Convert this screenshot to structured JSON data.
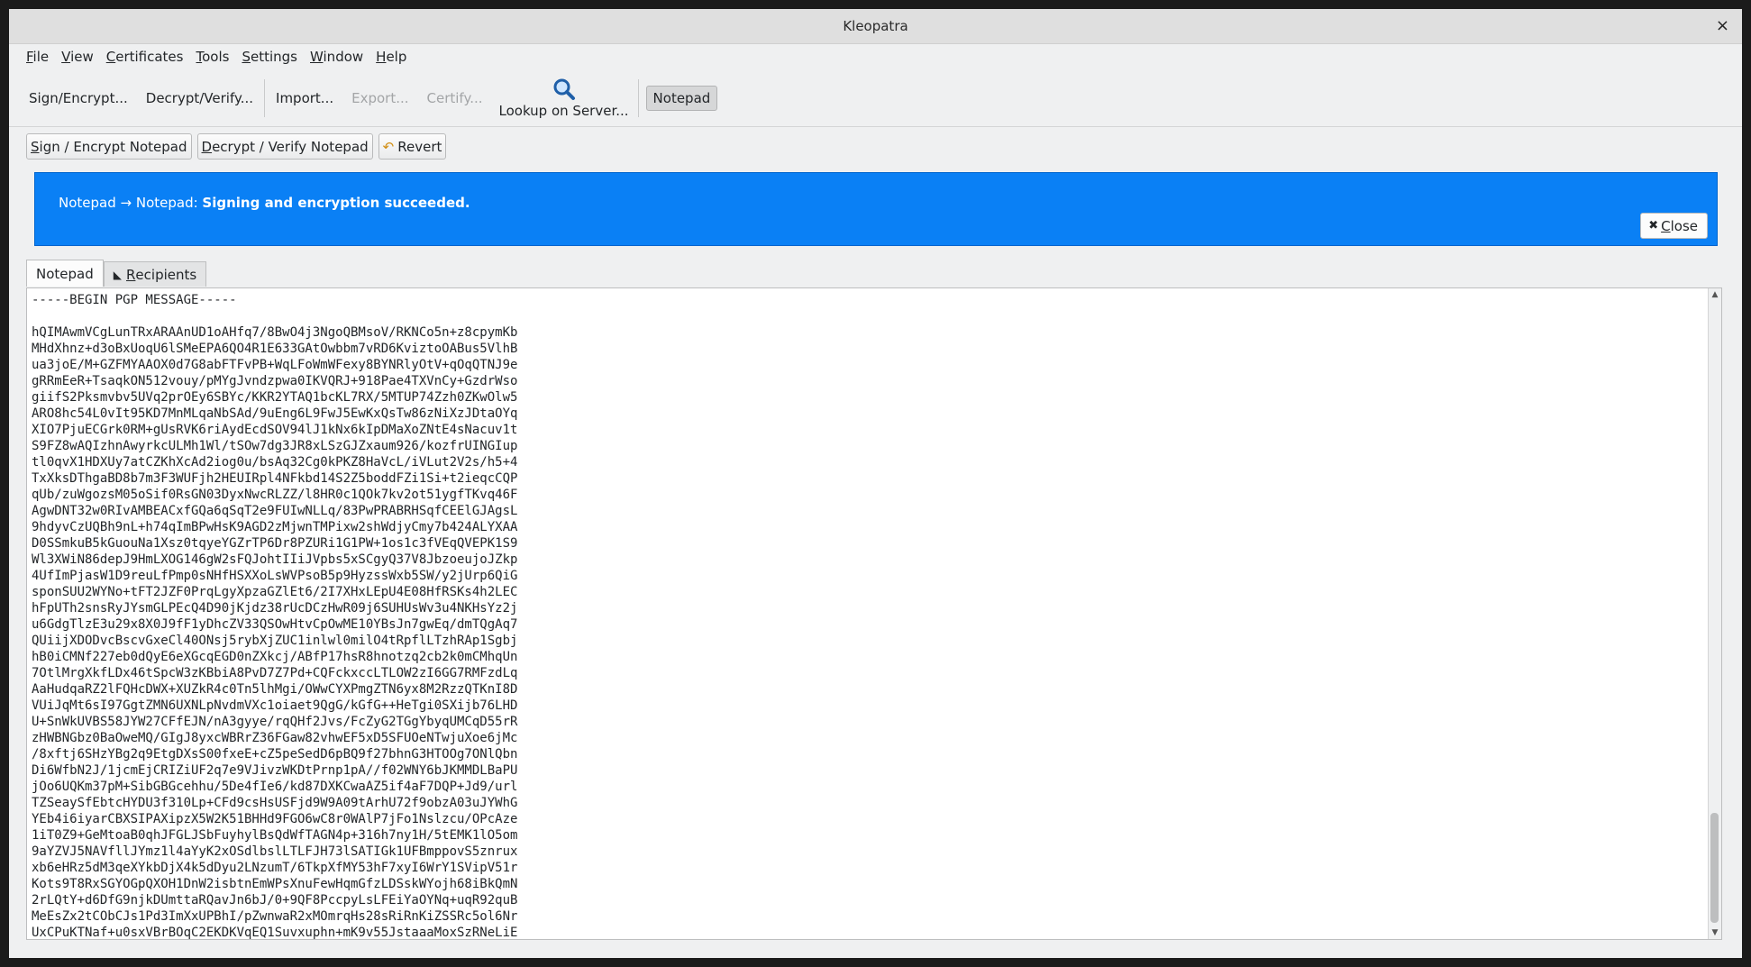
{
  "window": {
    "title": "Kleopatra",
    "close_glyph": "×"
  },
  "menu": [
    {
      "pre": "",
      "u": "F",
      "post": "ile"
    },
    {
      "pre": "",
      "u": "V",
      "post": "iew"
    },
    {
      "pre": "",
      "u": "C",
      "post": "ertificates"
    },
    {
      "pre": "",
      "u": "T",
      "post": "ools"
    },
    {
      "pre": "",
      "u": "S",
      "post": "ettings"
    },
    {
      "pre": "",
      "u": "W",
      "post": "indow"
    },
    {
      "pre": "",
      "u": "H",
      "post": "elp"
    }
  ],
  "toolbar": {
    "sign_encrypt": "Sign/Encrypt...",
    "decrypt_verify": "Decrypt/Verify...",
    "import": "Import...",
    "export": "Export...",
    "certify": "Certify...",
    "lookup": "Lookup on Server...",
    "notepad": "Notepad"
  },
  "actions": {
    "sign_encrypt_notepad": {
      "u": "S",
      "rest": "ign / Encrypt Notepad"
    },
    "decrypt_verify_notepad": {
      "u": "D",
      "rest": "ecrypt / Verify Notepad"
    },
    "revert": "Revert"
  },
  "banner": {
    "prefix": "Notepad → Notepad: ",
    "status": "Signing and encryption succeeded.",
    "close_u": "C",
    "close_rest": "lose",
    "color": "#0a80f5"
  },
  "tabs": {
    "notepad": "Notepad",
    "recipients_u": "R",
    "recipients_rest": "ecipients"
  },
  "editor": {
    "text": "-----BEGIN PGP MESSAGE-----\n\nhQIMAwmVCgLunTRxARAAnUD1oAHfq7/8BwO4j3NgoQBMsoV/RKNCo5n+z8cpymKb\nMHdXhnz+d3oBxUoqU6lSMeEPA6QO4R1E633GAtOwbbm7vRD6KviztoOABus5VlhB\nua3joE/M+GZFMYAAOX0d7G8abFTFvPB+WqLFoWmWFexy8BYNRlyOtV+qOqQTNJ9e\ngRRmEeR+TsaqkON512vouy/pMYgJvndzpwa0IKVQRJ+918Pae4TXVnCy+GzdrWso\ngiifS2Pksmvbv5UVq2prOEy6SBYc/KKR2YTAQ1bcKL7RX/5MTUP74Zzh0ZKwOlw5\nARO8hc54L0vIt95KD7MnMLqaNbSAd/9uEng6L9FwJ5EwKxQsTw86zNiXzJDtaOYq\nXIO7PjuECGrk0RM+gUsRVK6riAydEcdSOV94lJ1kNx6kIpDMaXoZNtE4sNacuv1t\nS9FZ8wAQIzhnAwyrkcULMh1Wl/tSOw7dg3JR8xLSzGJZxaum926/kozfrUINGIup\ntl0qvX1HDXUy7atCZKhXcAd2iog0u/bsAq32Cg0kPKZ8HaVcL/iVLut2V2s/h5+4\nTxXksDThgaBD8b7m3F3WUFjh2HEUIRpl4NFkbd14S2Z5boddFZi1Si+t2ieqcCQP\nqUb/zuWgozsM05oSif0RsGN03DyxNwcRLZZ/l8HR0c1QOk7kv2ot51ygfTKvq46F\nAgwDNT32w0RIvAMBEACxfGQa6qSqT2e9FUIwNLLq/83PwPRABRHSqfCEElGJAgsL\n9hdyvCzUQBh9nL+h74qImBPwHsK9AGD2zMjwnTMPixw2shWdjyCmy7b424ALYXAA\nD0SSmkuB5kGuouNa1Xsz0tqyeYGZrTP6Dr8PZURi1G1PW+1os1c3fVEqQVEPK1S9\nWl3XWiN86depJ9HmLXOG146gW2sFQJohtIIiJVpbs5xSCgyQ37V8JbzoeujoJZkp\n4UfImPjasW1D9reuLfPmp0sNHfHSXXoLsWVPsoB5p9HyzssWxb5SW/y2jUrp6QiG\nsponSUU2WYNo+tFT2JZF0PrqLgyXpzaGZlEt6/2I7XHxLEpU4E08HfRSKs4h2LEC\nhFpUTh2snsRyJYsmGLPEcQ4D90jKjdz38rUcDCzHwR09j6SUHUsWv3u4NKHsYz2j\nu6GdgTlzE3u29x8X0J9fF1yDhcZV33QSOwHtvCpOwME10YBsJn7gwEq/dmTQgAq7\nQUiijXDODvcBscvGxeCl40ONsj5rybXjZUC1inlwl0milO4tRpflLTzhRAp1Sgbj\nhB0iCMNf227eb0dQyE6eXGcqEGD0nZXkcj/ABfP17hsR8hnotzq2cb2k0mCMhqUn\n7OtlMrgXkfLDx46tSpcW3zKBbiA8PvD7Z7Pd+CQFckxccLTLOW2zI6GG7RMFzdLq\nAaHudqaRZ2lFQHcDWX+XUZkR4c0Tn5lhMgi/OWwCYXPmgZTN6yx8M2RzzQTKnI8D\nVUiJqMt6sI97GgtZMN6UXNLpNvdmVXc1oiaet9QgG/kGfG++HeTgi0SXijb76LHD\nU+SnWkUVBS58JYW27CFfEJN/nA3gyye/rqQHf2Jvs/FcZyG2TGgYbyqUMCqD55rR\nzHWBNGbz0BaOweMQ/GIgJ8yxcWBRrZ36FGaw82vhwEF5xD5SFUOeNTwjuXoe6jMc\n/8xftj6SHzYBg2q9EtgDXsS00fxeE+cZ5peSedD6pBQ9f27bhnG3HTOOg7ONlQbn\nDi6WfbN2J/1jcmEjCRIZiUF2q7e9VJivzWKDtPrnp1pA//f02WNY6bJKMMDLBaPU\njOo6UQKm37pM+SibGBGcehhu/5De4fIe6/kd87DXKCwaAZ5if4aF7DQP+Jd9/url\nTZSeaySfEbtcHYDU3f310Lp+CFd9csHsUSFjd9W9A09tArhU72f9obzA03uJYWhG\nYEb4i6iyarCBXSIPAXipzX5W2K51BHHd9FGO6wC8r0WAlP7jFo1Nslzcu/OPcAze\n1iT0Z9+GeMtoaB0qhJFGLJSbFuyhylBsQdWfTAGN4p+316h7ny1H/5tEMK1lO5om\n9aYZVJ5NAVfllJYmz1l4aYyK2xOSdlbslLTLFJH73lSATIGk1UFBmppovS5znrux\nxb6eHRz5dM3qeXYkbDjX4k5dDyu2LNzumT/6TkpXfMY53hF7xyI6WrY1SVipV51r\nKots9T8RxSGYOGpQXOH1DnW2isbtnEmWPsXnuFewHqmGfzLDSskWYojh68iBkQmN\n2rLQtY+d6DfG9njkDUmttaRQavJn6bJ/0+9QF8PccpyLsLFEiYaOYNq+uqR92quB\nMeEsZx2tCObCJs1Pd3ImXxUPBhI/pZwnwaR2xMOmrqHs28sRiRnKiZSSRc5ol6Nr\nUxCPuKTNaf+u0sxVBrBOqC2EKDKVqEQ1Suvxuphn+mK9v55JstaaaMoxSzRNeLiE"
  }
}
